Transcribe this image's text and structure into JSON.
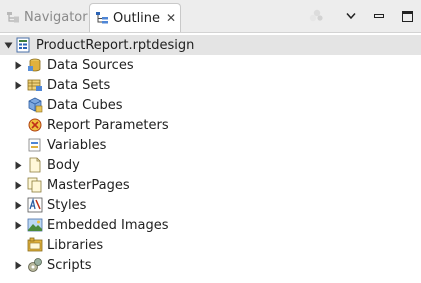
{
  "tabs": [
    {
      "label": "Navigator",
      "active": false,
      "icon": "navigator-icon"
    },
    {
      "label": "Outline",
      "active": true,
      "icon": "outline-icon",
      "close_glyph": "✕"
    }
  ],
  "toolbar": {
    "icons": [
      "link-with-editor-icon",
      "view-menu-icon",
      "minimize-icon",
      "maximize-icon"
    ]
  },
  "tree": {
    "root": {
      "label": "ProductReport.rptdesign",
      "icon": "report-design-icon",
      "expanded": true
    },
    "items": [
      {
        "label": "Data Sources",
        "icon": "data-sources-icon",
        "expandable": true
      },
      {
        "label": "Data Sets",
        "icon": "data-sets-icon",
        "expandable": true
      },
      {
        "label": "Data Cubes",
        "icon": "data-cubes-icon",
        "expandable": false
      },
      {
        "label": "Report Parameters",
        "icon": "report-parameters-icon",
        "expandable": false
      },
      {
        "label": "Variables",
        "icon": "variables-icon",
        "expandable": false
      },
      {
        "label": "Body",
        "icon": "body-icon",
        "expandable": true
      },
      {
        "label": "MasterPages",
        "icon": "master-pages-icon",
        "expandable": true
      },
      {
        "label": "Styles",
        "icon": "styles-icon",
        "expandable": true
      },
      {
        "label": "Embedded Images",
        "icon": "embedded-images-icon",
        "expandable": true
      },
      {
        "label": "Libraries",
        "icon": "libraries-icon",
        "expandable": false
      },
      {
        "label": "Scripts",
        "icon": "scripts-icon",
        "expandable": true
      }
    ]
  }
}
